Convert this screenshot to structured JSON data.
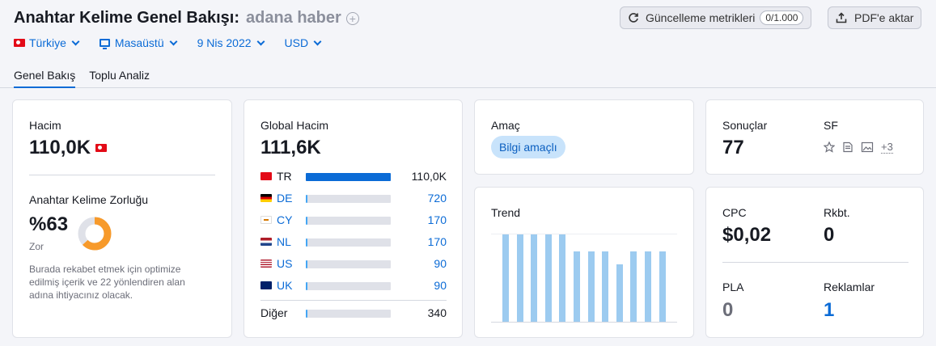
{
  "header": {
    "title": "Anahtar Kelime Genel Bakışı:",
    "keyword": "adana haber",
    "update_button": "Güncelleme metrikleri",
    "update_quota": "0/1.000",
    "pdf_button": "PDF'e aktar"
  },
  "filters": {
    "country": "Türkiye",
    "device": "Masaüstü",
    "date": "9 Nis 2022",
    "currency": "USD"
  },
  "tabs": [
    "Genel Bakış",
    "Toplu Analiz"
  ],
  "volume": {
    "label": "Hacim",
    "value": "110,0K",
    "difficulty_label": "Anahtar Kelime Zorluğu",
    "difficulty_value": "%63",
    "difficulty_level": "Zor",
    "difficulty_percent": 63,
    "description": "Burada rekabet etmek için optimize edilmiş içerik ve 22 yönlendiren alan adına ihtiyacınız olacak."
  },
  "global_volume": {
    "label": "Global Hacim",
    "value": "111,6K",
    "rows": [
      {
        "code": "TR",
        "value": "110,0K",
        "share": 1.0
      },
      {
        "code": "DE",
        "value": "720",
        "share": 0.02
      },
      {
        "code": "CY",
        "value": "170",
        "share": 0.02
      },
      {
        "code": "NL",
        "value": "170",
        "share": 0.02
      },
      {
        "code": "US",
        "value": "90",
        "share": 0.02
      },
      {
        "code": "UK",
        "value": "90",
        "share": 0.02
      }
    ],
    "other_label": "Diğer",
    "other_value": "340",
    "other_share": 0.02
  },
  "intent": {
    "label": "Amaç",
    "badge": "Bilgi amaçlı"
  },
  "trend": {
    "label": "Trend",
    "values": [
      1.0,
      1.0,
      1.0,
      1.0,
      1.0,
      0.81,
      0.81,
      0.81,
      0.66,
      0.81,
      0.81,
      0.81
    ]
  },
  "results": {
    "label": "Sonuçlar",
    "value": "77",
    "sf_label": "SF",
    "sf_more": "+3"
  },
  "cpc": {
    "label": "CPC",
    "value": "$0,02",
    "competition_label": "Rkbt.",
    "competition_value": "0",
    "pla_label": "PLA",
    "pla_value": "0",
    "ads_label": "Reklamlar",
    "ads_value": "1"
  },
  "colors": {
    "accent": "#0b6bd6",
    "difficulty": "#f79a2b",
    "trend_bar": "#9ccbf0",
    "intent_badge": "#c8e3fb"
  }
}
